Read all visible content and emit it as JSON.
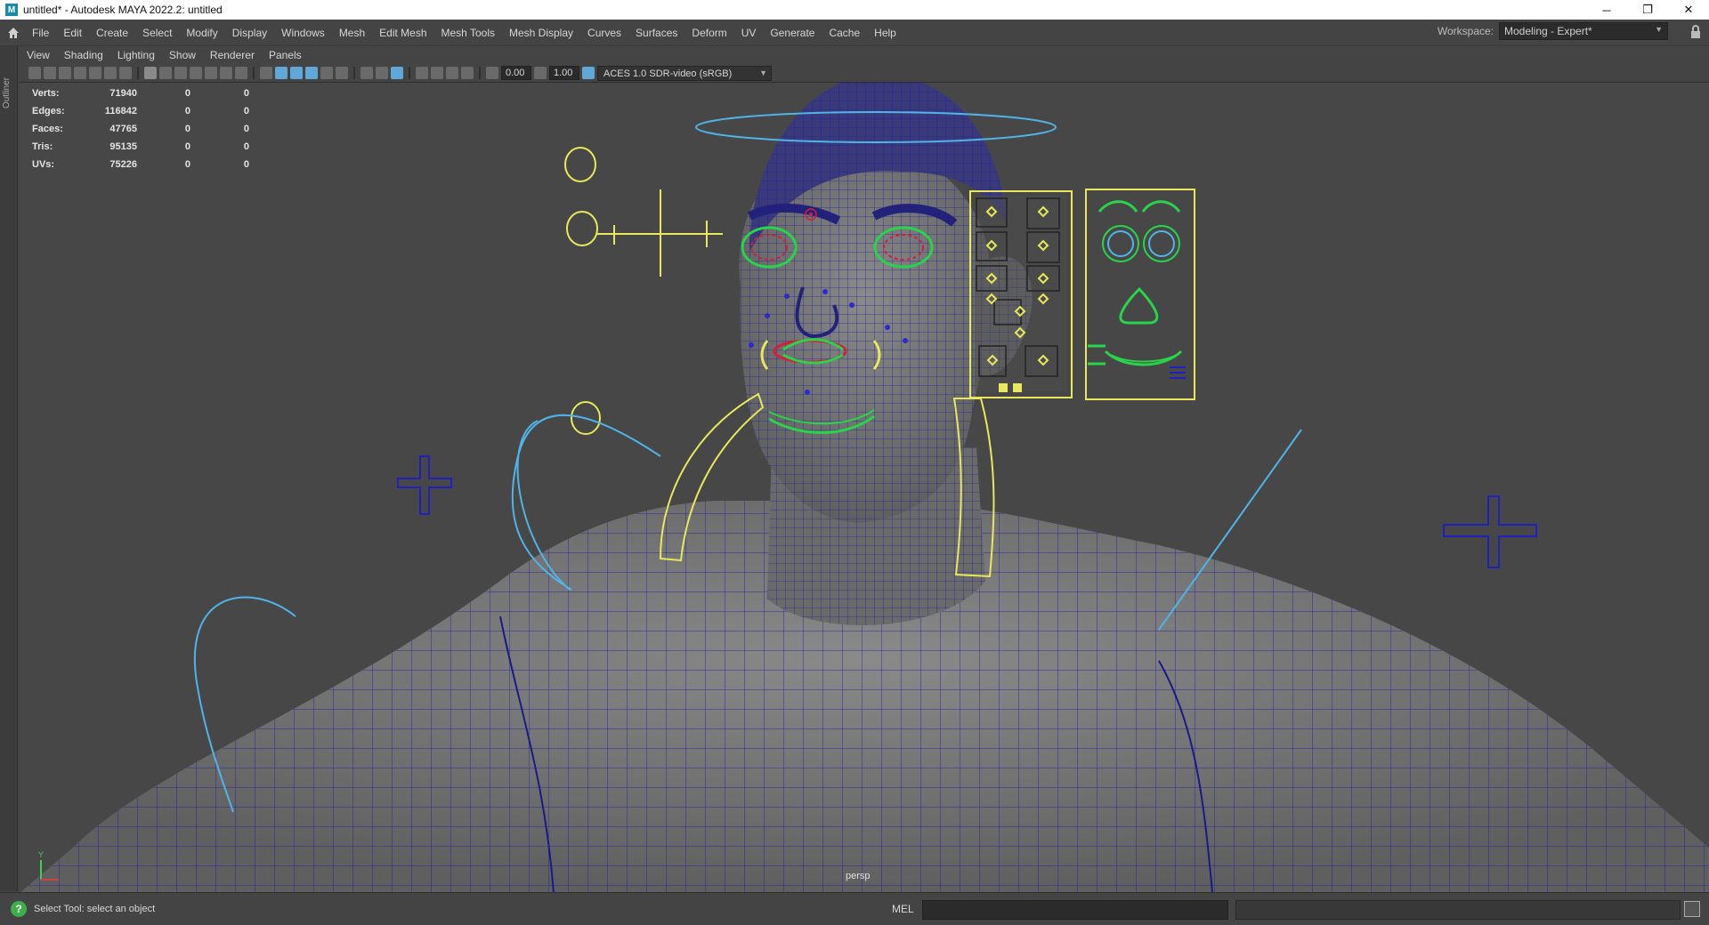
{
  "window": {
    "title": "untitled* - Autodesk MAYA 2022.2: untitled",
    "app_icon": "M",
    "controls": [
      "─",
      "❐",
      "✕"
    ]
  },
  "menubar": {
    "items": [
      "File",
      "Edit",
      "Create",
      "Select",
      "Modify",
      "Display",
      "Windows",
      "Mesh",
      "Edit Mesh",
      "Mesh Tools",
      "Mesh Display",
      "Curves",
      "Surfaces",
      "Deform",
      "UV",
      "Generate",
      "Cache",
      "Help"
    ],
    "workspace_label": "Workspace:",
    "workspace_value": "Modeling - Expert*"
  },
  "left_tab": {
    "label": "Outliner"
  },
  "panel_menu": {
    "items": [
      "View",
      "Shading",
      "Lighting",
      "Show",
      "Renderer",
      "Panels"
    ]
  },
  "panel_toolbar": {
    "exposure": "0.00",
    "gamma": "1.00",
    "color_space": "ACES 1.0 SDR-video (sRGB)"
  },
  "hud": {
    "rows": [
      {
        "label": "Verts:",
        "v1": "71940",
        "v2": "0",
        "v3": "0"
      },
      {
        "label": "Edges:",
        "v1": "116842",
        "v2": "0",
        "v3": "0"
      },
      {
        "label": "Faces:",
        "v1": "47765",
        "v2": "0",
        "v3": "0"
      },
      {
        "label": "Tris:",
        "v1": "95135",
        "v2": "0",
        "v3": "0"
      },
      {
        "label": "UVs:",
        "v1": "75226",
        "v2": "0",
        "v3": "0"
      }
    ]
  },
  "viewport": {
    "camera": "persp",
    "axis_y": "Y",
    "colors": {
      "wire": "#1f1f9e",
      "control_yellow": "#e8e85a",
      "control_blue": "#4fb4e8",
      "control_green": "#28d44a",
      "control_red": "#d21f3a"
    }
  },
  "statusbar": {
    "help_text": "Select Tool: select an object",
    "mel_label": "MEL"
  }
}
